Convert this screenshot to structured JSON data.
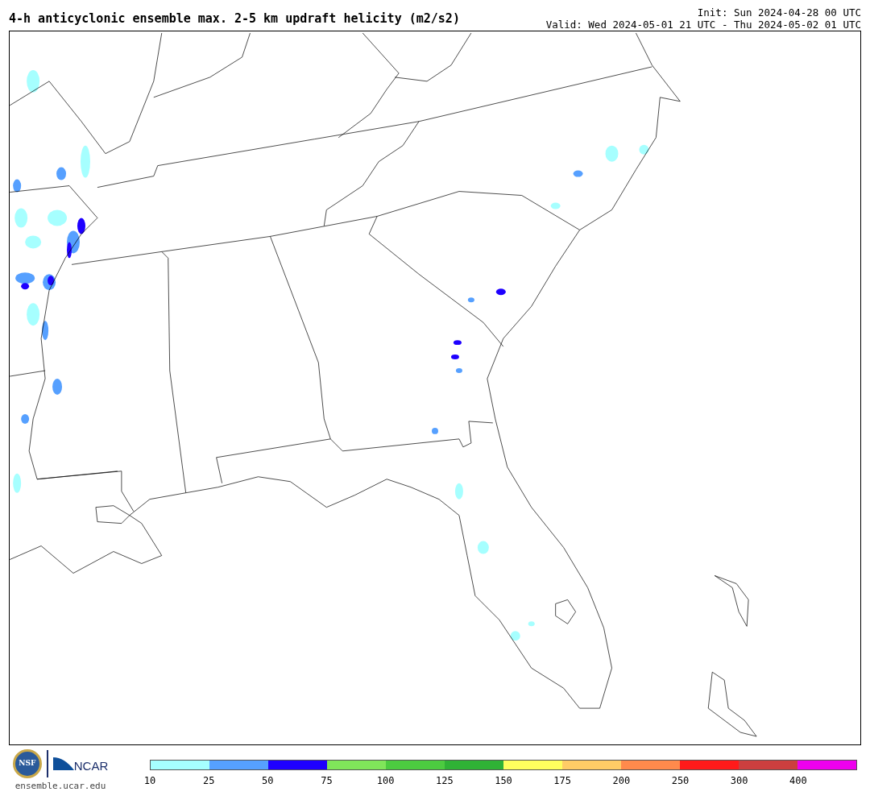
{
  "title": "4-h anticyclonic ensemble max. 2-5 km updraft helicity (m2/s2)",
  "init": "Init: Sun 2024-04-28 00 UTC",
  "valid": "Valid: Wed 2024-05-01 21 UTC - Thu 2024-05-02 01 UTC",
  "logo": {
    "seal_text": "NSF",
    "wordmark": "NCAR",
    "url": "ensemble.ucar.edu"
  },
  "colorbar": {
    "bins": [
      {
        "color": "#a6ffff",
        "label": "10"
      },
      {
        "color": "#56a0ff",
        "label": "25"
      },
      {
        "color": "#1e00ff",
        "label": "50"
      },
      {
        "color": "#80e55a",
        "label": "75"
      },
      {
        "color": "#4ccb40",
        "label": "100"
      },
      {
        "color": "#2fb236",
        "label": "125"
      },
      {
        "color": "#ffff5e",
        "label": "150"
      },
      {
        "color": "#ffcc66",
        "label": "175"
      },
      {
        "color": "#ff8a4c",
        "label": "200"
      },
      {
        "color": "#ff1a1a",
        "label": "250"
      },
      {
        "color": "#cc3f3f",
        "label": "300"
      },
      {
        "color": "#ee00ee",
        "label": "400"
      }
    ]
  }
}
